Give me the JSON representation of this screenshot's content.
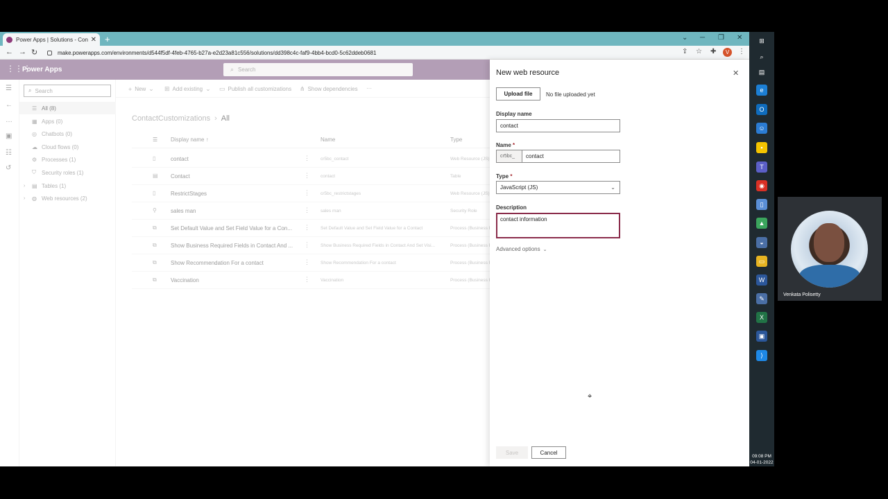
{
  "browser": {
    "tab_title": "Power Apps | Solutions - Contact",
    "url": "make.powerapps.com/environments/d544f5df-4feb-4765-b27a-e2d23a81c556/solutions/dd398c4c-faf9-4bb4-bcd0-5c62ddeb0681",
    "profile_initial": "V"
  },
  "app": {
    "name": "Power Apps",
    "search_placeholder": "Search"
  },
  "tree": {
    "search_placeholder": "Search",
    "items": [
      {
        "label": "All (8)",
        "icon": "list-icon"
      },
      {
        "label": "Apps (0)",
        "icon": "apps-icon"
      },
      {
        "label": "Chatbots (0)",
        "icon": "chatbot-icon"
      },
      {
        "label": "Cloud flows (0)",
        "icon": "cloud-flow-icon"
      },
      {
        "label": "Processes (1)",
        "icon": "process-icon"
      },
      {
        "label": "Security roles (1)",
        "icon": "security-role-icon"
      },
      {
        "label": "Tables (1)",
        "icon": "table-icon"
      },
      {
        "label": "Web resources (2)",
        "icon": "globe-icon"
      }
    ]
  },
  "commands": {
    "new": "New",
    "add_existing": "Add existing",
    "publish": "Publish all customizations",
    "dependencies": "Show dependencies",
    "more": "···"
  },
  "breadcrumb": {
    "parent": "ContactCustomizations",
    "current": "All"
  },
  "grid": {
    "headers": {
      "display_name": "Display name ↑",
      "name": "Name",
      "type": "Type"
    },
    "rows": [
      {
        "display_name": "contact",
        "name": "cr5bc_contact",
        "type": "Web Resource (JS)"
      },
      {
        "display_name": "Contact",
        "name": "contact",
        "type": "Table"
      },
      {
        "display_name": "RestrictStages",
        "name": "cr5bc_restrictstages",
        "type": "Web Resource (JS)"
      },
      {
        "display_name": "sales man",
        "name": "sales man",
        "type": "Security Role"
      },
      {
        "display_name": "Set Default Value and Set Field Value for a Con...",
        "name": "Set Default Value and Set Field Value for a Contact",
        "type": "Process (Business Rule)"
      },
      {
        "display_name": "Show Business Required Fields in Contact And ...",
        "name": "Show Business Required Fields in Contact And Set Visi...",
        "type": "Process (Business Rule)"
      },
      {
        "display_name": "Show Recommendation For a contact",
        "name": "Show Recommendation For a contact",
        "type": "Process (Business Rule)"
      },
      {
        "display_name": "Vaccination",
        "name": "Vaccination",
        "type": "Process (Business Rule)"
      }
    ]
  },
  "panel": {
    "title": "New web resource",
    "upload_label": "Upload file",
    "upload_status": "No file uploaded yet",
    "display_name_label": "Display name",
    "display_name_value": "contact",
    "name_label": "Name",
    "name_prefix": "cr5bc_",
    "name_value": "contact",
    "type_label": "Type",
    "type_value": "JavaScript (JS)",
    "description_label": "Description",
    "description_value": "contact information",
    "advanced_label": "Advanced options",
    "save_label": "Save",
    "cancel_label": "Cancel",
    "required_mark": "*"
  },
  "taskbar": {
    "time": "09:08 PM",
    "date": "04-01-2022"
  },
  "webcam": {
    "name": "Venkata Polisetty"
  },
  "colors": {
    "app_header": "#8a6b8f",
    "browser_chrome": "#6fb6bf",
    "description_border": "#8a2b4a",
    "taskbar": "#1f2a30"
  }
}
